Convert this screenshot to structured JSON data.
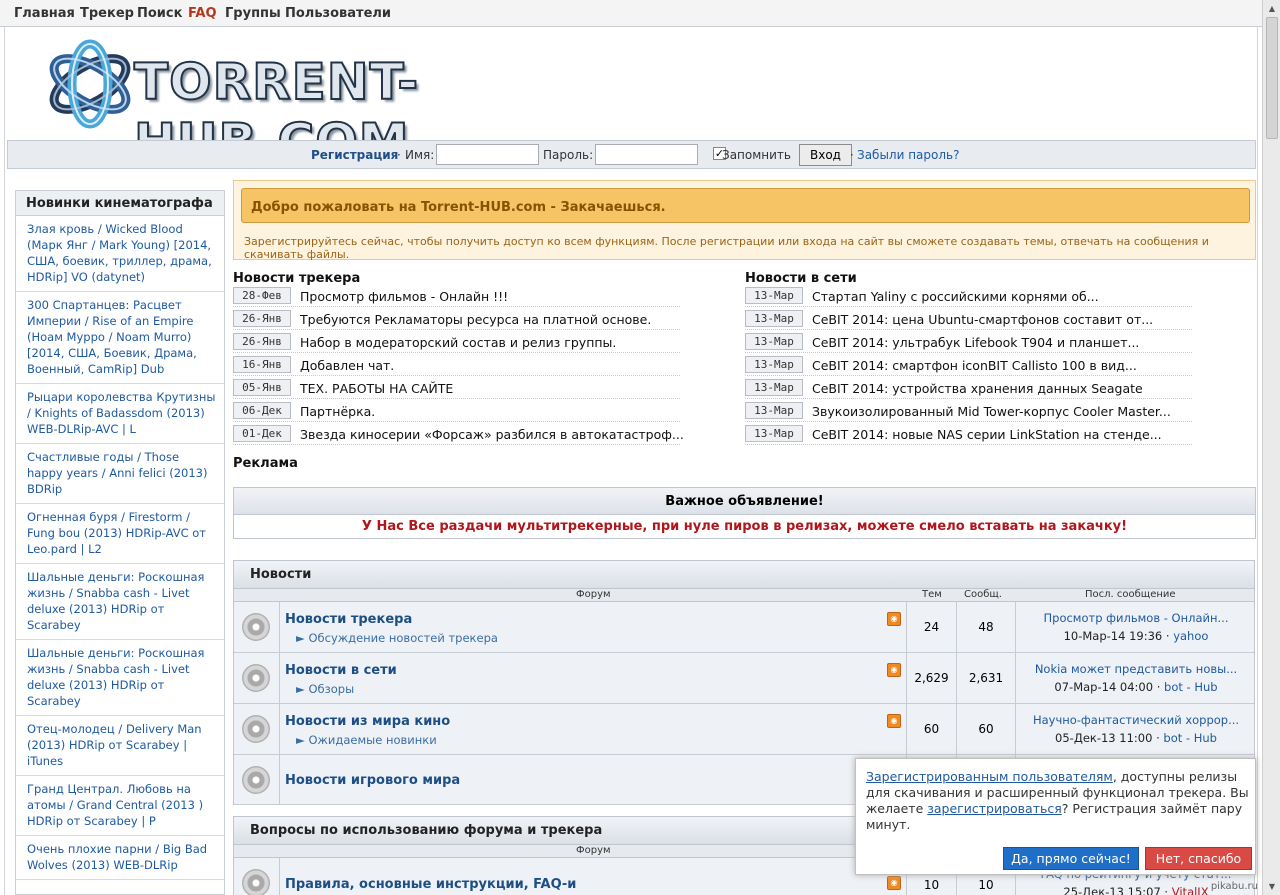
{
  "nav": [
    "Главная",
    "Трекер",
    "Поиск",
    "FAQ",
    "Группы",
    "Пользователи"
  ],
  "logo_text": "TORRENT-HUB.COM",
  "login": {
    "register": "Регистрация",
    "dot1": "·",
    "name_label": "Имя:",
    "password_label": "Пароль:",
    "remember_label": "Запомнить",
    "remember_mark": "✓",
    "login_button": "Вход",
    "dot2": "·",
    "forgot": "Забыли пароль?"
  },
  "sidebar": {
    "title": "Новинки кинематографа",
    "items": [
      "Злая кровь / Wicked Blood (Марк Янг / Mark Young) [2014, США, боевик, триллер, драма, HDRip] VO (datynet)",
      "300 Спартанцев: Расцвет Империи / Rise of an Empire (Ноам Мурро / Noam Murro) [2014, США, Боевик, Драма, Военный, CamRip] Dub",
      "Рыцари королевства Крутизны / Knights of Badassdom (2013) WEB-DLRip-AVC | L",
      "Счастливые годы / Those happy years / Anni felici (2013) BDRip",
      "Огненная буря / Firestorm / Fung bou (2013) HDRip-AVC от Leo.pard | L2",
      "Шальные деньги: Роскошная жизнь / Snabba cash - Livet deluxe (2013) HDRip от Scarabey",
      "Шальные деньги: Роскошная жизнь / Snabba cash - Livet deluxe (2013) HDRip от Scarabey",
      "Отец-молодец / Delivery Man (2013) HDRip от Scarabey | iTunes",
      "Гранд Централ. Любовь на атомы / Grand Central (2013 ) HDRip от Scarabey | P",
      "Очень плохие парни / Big Bad Wolves (2013) WEB-DLRip"
    ]
  },
  "welcome": {
    "title": "Добро пожаловать на Torrent-HUB.com - Закачаешься.",
    "text": "Зарегистрируйтесь сейчас, чтобы получить доступ ко всем функциям. После регистрации или входа на сайт вы сможете создавать темы, отвечать на сообщения и скачивать файлы."
  },
  "tracker_news": {
    "title": "Новости трекера",
    "items": [
      {
        "date": "28-Фев",
        "text": "Просмотр фильмов - Онлайн !!!"
      },
      {
        "date": "26-Янв",
        "text": "Требуются Рекламаторы ресурса на платной основе."
      },
      {
        "date": "26-Янв",
        "text": "Набор в модераторский состав и релиз группы."
      },
      {
        "date": "16-Янв",
        "text": "Добавлен чат."
      },
      {
        "date": "05-Янв",
        "text": "ТЕХ. РАБОТЫ НА САЙТЕ"
      },
      {
        "date": "06-Дек",
        "text": "Партнёрка."
      },
      {
        "date": "01-Дек",
        "text": "Звезда киносерии «Форсаж» разбился в автокатастроф..."
      }
    ]
  },
  "net_news": {
    "title": "Новости в сети",
    "items": [
      {
        "date": "13-Мар",
        "text": "Стартап Yaliny с российскими корнями об..."
      },
      {
        "date": "13-Мар",
        "text": "CeBIT 2014: цена Ubuntu-смартфонов составит от..."
      },
      {
        "date": "13-Мар",
        "text": "CeBIT 2014: ультрабук Lifebook T904 и планшет..."
      },
      {
        "date": "13-Мар",
        "text": "CeBIT 2014: смартфон iconBIT Callisto 100 в вид..."
      },
      {
        "date": "13-Мар",
        "text": "CeBIT 2014: устройства хранения данных Seagate"
      },
      {
        "date": "13-Мар",
        "text": "Звукоизолированный Mid Tower-корпус Cooler Master..."
      },
      {
        "date": "13-Мар",
        "text": "CeBIT 2014: новые NAS серии LinkStation на стенде..."
      }
    ]
  },
  "ads_title": "Реклама",
  "announcement": {
    "title": "Важное объявление!",
    "text": "У Нас Все раздачи мультитрекерные, при нуле пиров в релизах, можете смело вставать на закачку!"
  },
  "forum_headers": {
    "forum": "Форум",
    "topics": "Тем",
    "posts": "Сообщ.",
    "last": "Посл. сообщение"
  },
  "news_section": {
    "title": "Новости",
    "rows": [
      {
        "name": "Новости трекера",
        "sub": "► Обсуждение новостей трекера",
        "topics": "24",
        "posts": "48",
        "last_title": "Просмотр фильмов - Онлайн...",
        "last_date": "10-Мар-14 19:36",
        "last_user": "yahoo"
      },
      {
        "name": "Новости в сети",
        "sub": "► Обзоры",
        "topics": "2,629",
        "posts": "2,631",
        "last_title": "Nokia может представить новы...",
        "last_date": "07-Мар-14 04:00",
        "last_user": "bot - Hub"
      },
      {
        "name": "Новости из мира кино",
        "sub": "► Ожидаемые новинки",
        "topics": "60",
        "posts": "60",
        "last_title": "Научно-фантастический хоррор...",
        "last_date": "05-Дек-13 11:00",
        "last_user": "bot - Hub"
      },
      {
        "name": "Новости игрового мира"
      }
    ]
  },
  "faq_section": {
    "title": "Вопросы по использованию форума и трекера",
    "rows": [
      {
        "name": "Правила, основные инструкции, FAQ-и",
        "topics": "10",
        "posts": "10",
        "last_title": "FAQ по рейтингу и учету стат...",
        "last_date": "25-Дек-13 15:07",
        "last_user": "VitalIX"
      }
    ]
  },
  "popup": {
    "link1": "Зарегистрированным пользователям",
    "text1": ", доступны релизы для скачивания и расширенный функционал трекера. Вы желаете ",
    "link2": "зарегистрироваться",
    "text2": "? Регистрация займёт пару минут.",
    "yes_button": "Да, прямо сейчас!",
    "no_button": "Нет, спасибо"
  },
  "watermark": "pikabu.ru",
  "colors": {
    "accent": "#1f5aa0",
    "alert": "#b0171c",
    "welcome_bar": "#f6c365"
  }
}
